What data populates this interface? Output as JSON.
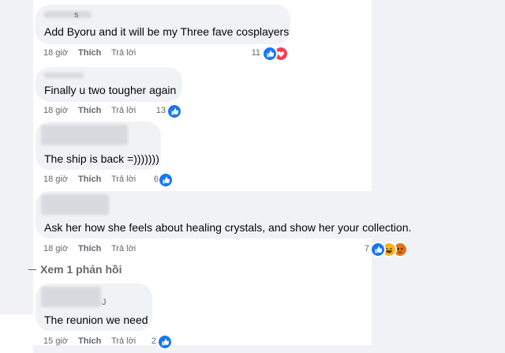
{
  "comments": [
    {
      "text": "Add Byoru and it will be my Three fave cosplayers",
      "time": "18 giờ",
      "like": "Thích",
      "reply": "Trả lời",
      "count": "11",
      "name_glyph": "s"
    },
    {
      "text": "Finally u two tougher again",
      "time": "18 giờ",
      "like": "Thích",
      "reply": "Trả lời",
      "count": "13",
      "name_glyph": ""
    },
    {
      "text": "The ship is back =)))))))",
      "time": "18 giờ",
      "like": "Thích",
      "reply": "Trả lời",
      "count": "6",
      "name_glyph": ""
    },
    {
      "text": "Ask her how she feels about healing crystals, and show her your collection.",
      "time": "18 giờ",
      "like": "Thích",
      "reply": "Trả lời",
      "count": "7",
      "name_glyph": ""
    },
    {
      "text": "The reunion we need",
      "time": "15 giờ",
      "like": "Thích",
      "reply": "Trả lời",
      "count": "2",
      "name_glyph": "J"
    }
  ],
  "view_replies": "Xem 1 phản hồi",
  "colors": {
    "like_blue": "#1877f2",
    "love_red": "#f33e58",
    "haha_yellow": "#f7b125",
    "angry_orange": "#e9710f",
    "bubble": "#f0f2f5",
    "meta": "#65676b"
  },
  "icons": [
    "like-icon",
    "love-icon",
    "haha-icon",
    "angry-icon"
  ]
}
